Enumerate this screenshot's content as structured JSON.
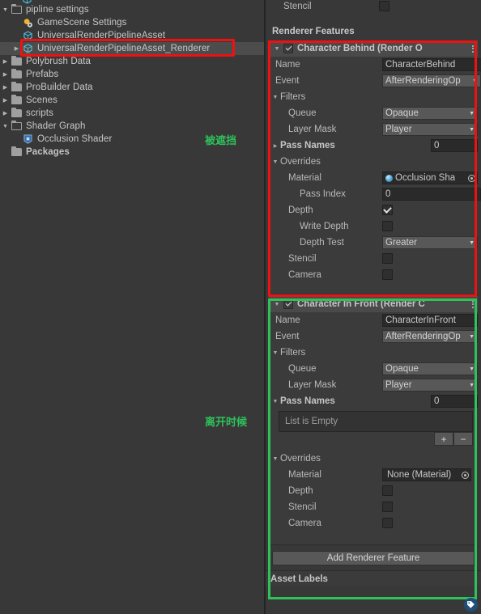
{
  "project_panel": {
    "name": "Project",
    "tree": [
      {
        "label": "",
        "indent": 1,
        "icon": "urp-asset-icon",
        "arrow": "none",
        "selected": false,
        "partial": true
      },
      {
        "label": "pipline settings",
        "indent": 0,
        "icon": "folder-open-icon",
        "arrow": "down",
        "selected": false
      },
      {
        "label": "GameScene Settings",
        "indent": 1,
        "icon": "settings-asset-icon",
        "arrow": "none",
        "selected": false
      },
      {
        "label": "UniversalRenderPipelineAsset",
        "indent": 1,
        "icon": "urp-asset-icon",
        "arrow": "none",
        "selected": false
      },
      {
        "label": "UniversalRenderPipelineAsset_Renderer",
        "indent": 1,
        "icon": "urp-asset-icon",
        "arrow": "right",
        "selected": true
      },
      {
        "label": "Polybrush Data",
        "indent": 0,
        "icon": "folder-icon",
        "arrow": "right",
        "selected": false
      },
      {
        "label": "Prefabs",
        "indent": 0,
        "icon": "folder-icon",
        "arrow": "right",
        "selected": false
      },
      {
        "label": "ProBuilder Data",
        "indent": 0,
        "icon": "folder-icon",
        "arrow": "right",
        "selected": false
      },
      {
        "label": "Scenes",
        "indent": 0,
        "icon": "folder-icon",
        "arrow": "right",
        "selected": false
      },
      {
        "label": "scripts",
        "indent": 0,
        "icon": "folder-icon",
        "arrow": "right",
        "selected": false
      },
      {
        "label": "Shader Graph",
        "indent": 0,
        "icon": "folder-open-icon",
        "arrow": "down",
        "selected": false
      },
      {
        "label": "Occlusion Shader",
        "indent": 1,
        "icon": "shader-asset-icon",
        "arrow": "none",
        "selected": false
      },
      {
        "label": "Packages",
        "indent": 0,
        "icon": "folder-icon",
        "arrow": "none",
        "selected": false,
        "bold": true
      }
    ]
  },
  "annotations": {
    "behind": "被遮挡",
    "in_front": "离开时候",
    "red_color": "#ee1111",
    "green_color": "#2fc15a"
  },
  "inspector": {
    "top_partial": {
      "stencil_label": "Stencil"
    },
    "renderer_features_header": "Renderer Features",
    "features": [
      {
        "title": "Character Behind (Render O",
        "enabled": true,
        "name_label": "Name",
        "name_value": "CharacterBehind",
        "event_label": "Event",
        "event_value": "AfterRenderingOp",
        "filters_label": "Filters",
        "queue_label": "Queue",
        "queue_value": "Opaque",
        "layer_mask_label": "Layer Mask",
        "layer_mask_value": "Player",
        "pass_names_label": "Pass Names",
        "pass_names_count": "0",
        "pass_names_expanded": false,
        "overrides_label": "Overrides",
        "material_label": "Material",
        "material_value": "Occlusion Sha",
        "material_empty": false,
        "pass_index_label": "Pass Index",
        "pass_index_value": "0",
        "depth_label": "Depth",
        "depth_checked": true,
        "write_depth_label": "Write Depth",
        "write_depth_checked": false,
        "depth_test_label": "Depth Test",
        "depth_test_value": "Greater",
        "stencil_label": "Stencil",
        "stencil_checked": false,
        "camera_label": "Camera",
        "camera_checked": false
      },
      {
        "title": "Character In Front (Render C",
        "enabled": true,
        "name_label": "Name",
        "name_value": "CharacterInFront",
        "event_label": "Event",
        "event_value": "AfterRenderingOp",
        "filters_label": "Filters",
        "queue_label": "Queue",
        "queue_value": "Opaque",
        "layer_mask_label": "Layer Mask",
        "layer_mask_value": "Player",
        "pass_names_label": "Pass Names",
        "pass_names_count": "0",
        "pass_names_expanded": true,
        "list_empty_text": "List is Empty",
        "list_add_label": "+",
        "list_remove_label": "−",
        "overrides_label": "Overrides",
        "material_label": "Material",
        "material_value": "None (Material)",
        "material_empty": true,
        "depth_label": "Depth",
        "depth_checked": false,
        "stencil_label": "Stencil",
        "stencil_checked": false,
        "camera_label": "Camera",
        "camera_checked": false
      }
    ],
    "add_renderer_feature_label": "Add Renderer Feature",
    "asset_labels_label": "Asset Labels"
  }
}
